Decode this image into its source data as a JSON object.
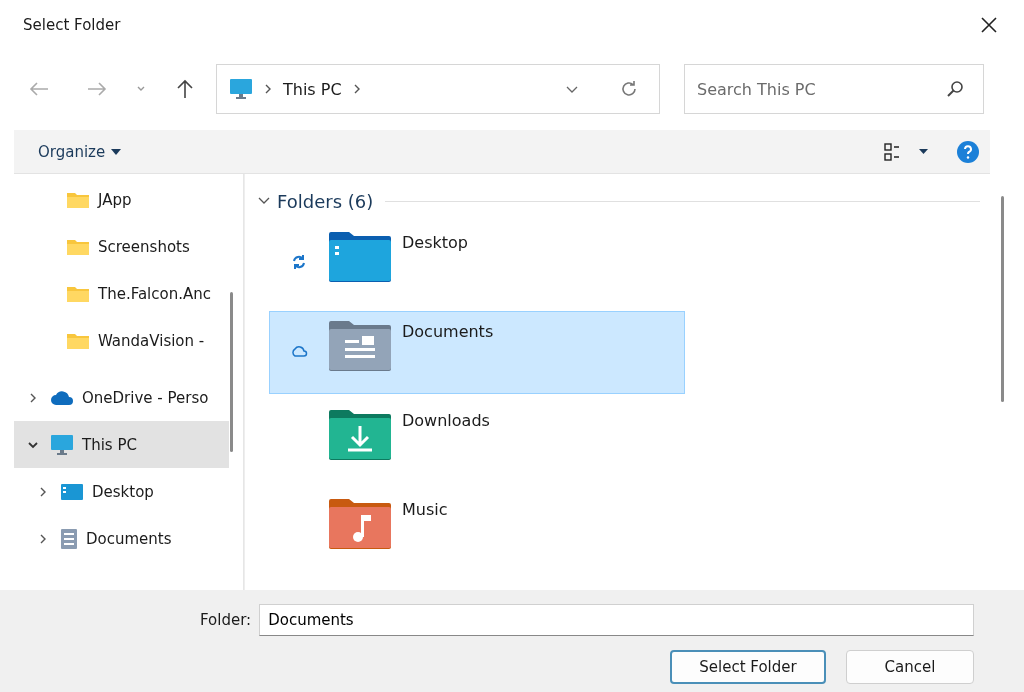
{
  "window": {
    "title": "Select Folder"
  },
  "address": {
    "segments": [
      "This PC"
    ]
  },
  "search": {
    "placeholder": "Search This PC"
  },
  "command_bar": {
    "organize": "Organize"
  },
  "sidebar": {
    "nested_items": [
      {
        "label": "JApp",
        "kind": "folder"
      },
      {
        "label": "Screenshots",
        "kind": "folder"
      },
      {
        "label": "The.Falcon.Anc",
        "kind": "folder"
      },
      {
        "label": "WandaVision -",
        "kind": "folder"
      }
    ],
    "items": [
      {
        "label": "OneDrive - Perso",
        "kind": "cloud",
        "expanded": false,
        "selected": false
      },
      {
        "label": "This PC",
        "kind": "pc",
        "expanded": true,
        "selected": true,
        "children": [
          {
            "label": "Desktop",
            "kind": "desktop",
            "expanded": false,
            "selected": false
          },
          {
            "label": "Documents",
            "kind": "documents",
            "expanded": false,
            "selected": false
          }
        ]
      }
    ]
  },
  "content": {
    "group": {
      "title": "Folders (6)",
      "expanded": true
    },
    "items": [
      {
        "name": "Desktop",
        "kind": "desktop",
        "syncing": true,
        "cloud_only": false,
        "selected": false
      },
      {
        "name": "Documents",
        "kind": "documents",
        "syncing": false,
        "cloud_only": true,
        "selected": true
      },
      {
        "name": "Downloads",
        "kind": "downloads",
        "syncing": false,
        "cloud_only": false,
        "selected": false
      },
      {
        "name": "Music",
        "kind": "music",
        "syncing": false,
        "cloud_only": false,
        "selected": false
      }
    ]
  },
  "footer": {
    "folder_label": "Folder:",
    "folder_value": "Documents",
    "buttons": [
      "Select Folder",
      "Cancel"
    ]
  }
}
